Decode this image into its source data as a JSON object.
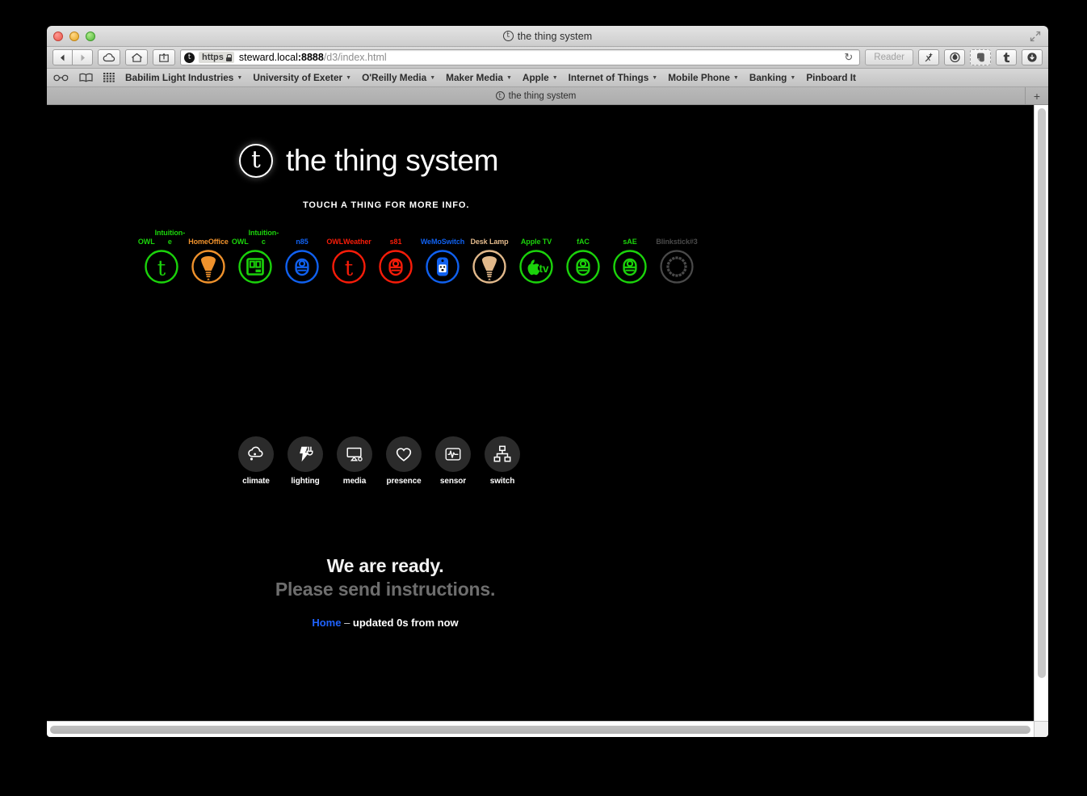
{
  "window": {
    "title": "the thing system",
    "favicon_glyph": "t"
  },
  "toolbar": {
    "back_icon": "back-arrow-icon",
    "forward_icon": "forward-arrow-icon",
    "icloud_icon": "cloud-icon",
    "home_icon": "home-icon",
    "share_icon": "share-icon",
    "scheme_label": "https",
    "url_host": "steward.local",
    "url_port": ":8888",
    "url_path": "/d3/index.html",
    "reload_glyph": "↻",
    "reader_label": "Reader",
    "ext_1": "magic-wand-icon",
    "ext_2": "ink-drop-icon",
    "ext_3": "evernote-icon",
    "ext_4": "tumblr-icon",
    "ext_5": "download-icon"
  },
  "bookmarks": {
    "reading_list_icon": "glasses-icon",
    "bookmarks_icon": "book-icon",
    "top_sites_icon": "grid-icon",
    "items": [
      {
        "label": "Babilim Light Industries",
        "has_menu": true
      },
      {
        "label": "University of Exeter",
        "has_menu": true
      },
      {
        "label": "O'Reilly Media",
        "has_menu": true
      },
      {
        "label": "Maker Media",
        "has_menu": true
      },
      {
        "label": "Apple",
        "has_menu": true
      },
      {
        "label": "Internet of Things",
        "has_menu": true
      },
      {
        "label": "Mobile Phone",
        "has_menu": true
      },
      {
        "label": "Banking",
        "has_menu": true
      },
      {
        "label": "Pinboard It",
        "has_menu": false
      }
    ]
  },
  "tabs": {
    "active": "the thing system",
    "new_tab_glyph": "+"
  },
  "page": {
    "logo_mark": "t",
    "logo_text": "the thing system",
    "touch_hint": "TOUCH A THING FOR MORE INFO.",
    "things": [
      {
        "label": "OWL\nIntuition-e",
        "color": "#1BD30B",
        "icon": "thing-t-icon",
        "style": "ring"
      },
      {
        "label": "Home\nOffice",
        "color": "#F0922C",
        "icon": "bulb-icon",
        "style": "ring"
      },
      {
        "label": "OWL\nIntuition-c",
        "color": "#1BD30B",
        "icon": "display-icon",
        "style": "ring"
      },
      {
        "label": "n85",
        "color": "#1061F0",
        "icon": "presence-fob-icon",
        "style": "ring"
      },
      {
        "label": "OWL\nWeather",
        "color": "#F81C09",
        "icon": "thing-t-icon",
        "style": "ring"
      },
      {
        "label": "s81",
        "color": "#F81C09",
        "icon": "presence-fob-icon",
        "style": "ring"
      },
      {
        "label": "WeMo\nSwitch",
        "color": "#1061F0",
        "icon": "wemo-outlet-icon",
        "style": "filled"
      },
      {
        "label": "Desk Lamp",
        "color": "#E2B98B",
        "icon": "bulb-icon",
        "style": "ring"
      },
      {
        "label": "Apple TV",
        "color": "#1BD30B",
        "icon": "appletv-icon",
        "style": "ring"
      },
      {
        "label": "fAC",
        "color": "#1BD30B",
        "icon": "presence-fob-icon",
        "style": "ring"
      },
      {
        "label": "sAE",
        "color": "#1BD30B",
        "icon": "presence-fob-icon",
        "style": "ring"
      },
      {
        "label": "Blinkstick\n#3",
        "color": "#4A4A4A",
        "icon": "blinkstick-ring-icon",
        "style": "segments"
      }
    ],
    "categories": [
      {
        "label": "climate",
        "icon": "cloud-rain-icon"
      },
      {
        "label": "lighting",
        "icon": "plug-bolt-icon"
      },
      {
        "label": "media",
        "icon": "monitor-icon"
      },
      {
        "label": "presence",
        "icon": "heart-icon"
      },
      {
        "label": "sensor",
        "icon": "waveform-icon"
      },
      {
        "label": "switch",
        "icon": "network-switch-icon"
      }
    ],
    "status_line_1": "We are ready.",
    "status_line_2": "Please send instructions.",
    "status_home": "Home",
    "status_dash": " – ",
    "status_updated": "updated 0s from now"
  }
}
